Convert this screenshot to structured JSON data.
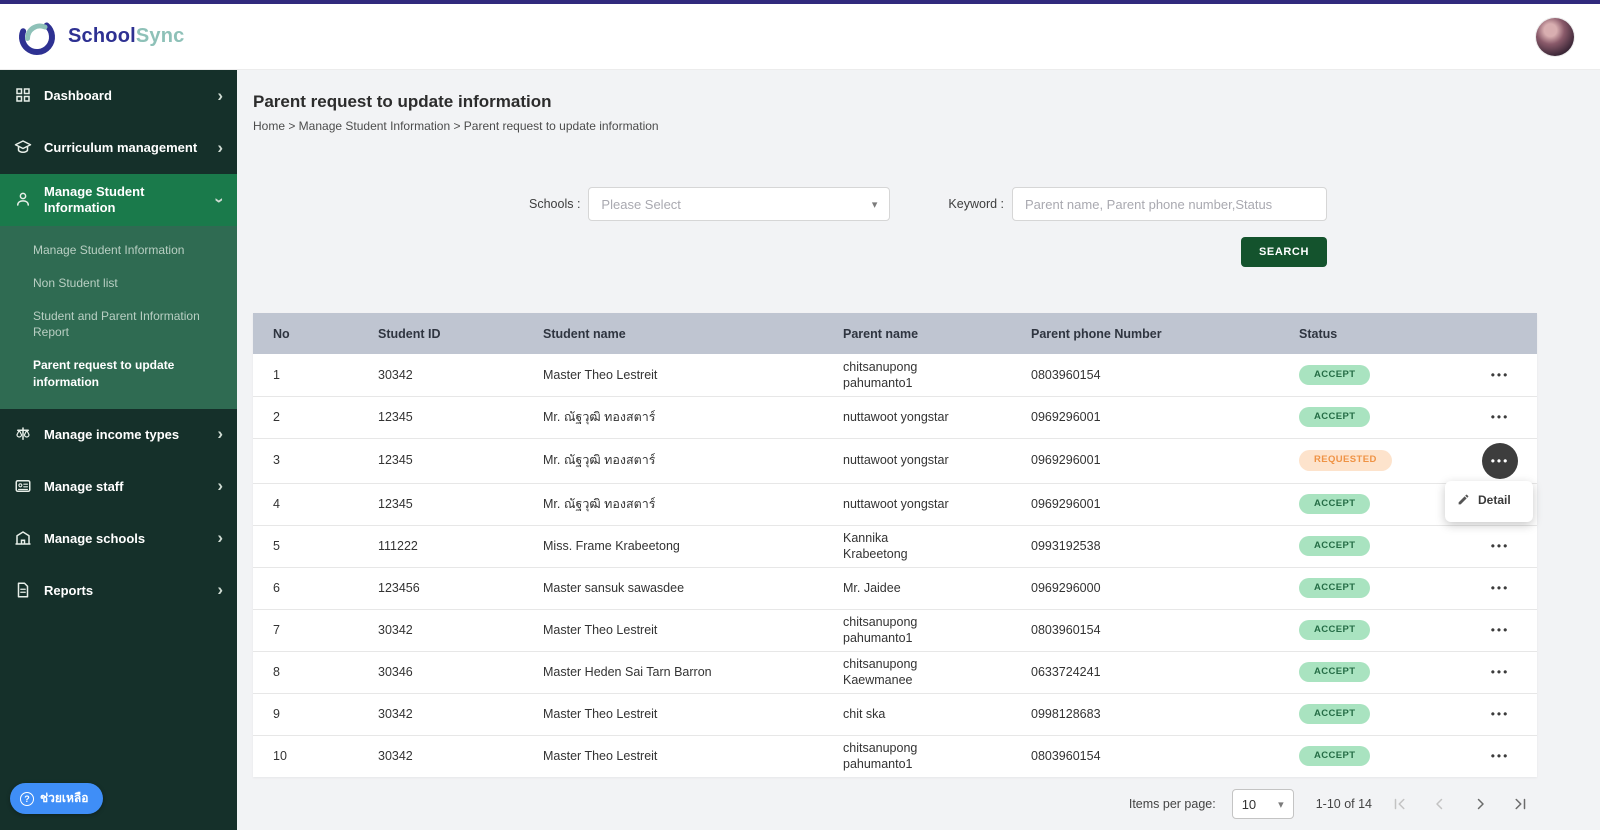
{
  "brand": {
    "school": "School",
    "sync": "Sync"
  },
  "sidebar": {
    "items": [
      {
        "label": "Dashboard",
        "icon": "dashboard-icon"
      },
      {
        "label": "Curriculum management",
        "icon": "curriculum-icon"
      },
      {
        "label": "Manage Student Information",
        "icon": "student-icon",
        "active": true,
        "expanded": true
      },
      {
        "label": "Manage income types",
        "icon": "income-icon"
      },
      {
        "label": "Manage staff",
        "icon": "staff-icon"
      },
      {
        "label": "Manage schools",
        "icon": "schools-icon"
      },
      {
        "label": "Reports",
        "icon": "reports-icon"
      }
    ],
    "submenu": [
      {
        "label": "Manage Student Information",
        "active": false
      },
      {
        "label": "Non Student list",
        "active": false
      },
      {
        "label": "Student and Parent Information Report",
        "active": false
      },
      {
        "label": "Parent request to update information",
        "active": true
      }
    ],
    "help_label": "ช่วยเหลือ"
  },
  "page": {
    "title": "Parent request to update information",
    "breadcrumb": "Home > Manage Student Information > Parent request to update information"
  },
  "filters": {
    "schools_label": "Schools :",
    "schools_placeholder": "Please Select",
    "keyword_label": "Keyword :",
    "keyword_placeholder": "Parent name, Parent phone number,Status",
    "search_label": "SEARCH"
  },
  "table": {
    "columns": [
      "No",
      "Student ID",
      "Student name",
      "Parent name",
      "Parent phone Number",
      "Status"
    ],
    "rows": [
      {
        "no": "1",
        "student_id": "30342",
        "student_name": "Master Theo Lestreit",
        "parent_name": "chitsanupong pahumanto1",
        "phone": "0803960154",
        "status": "ACCEPT"
      },
      {
        "no": "2",
        "student_id": "12345",
        "student_name": "Mr. ณัฐวุฒิ ทองสตาร์",
        "parent_name": "nuttawoot yongstar",
        "phone": "0969296001",
        "status": "ACCEPT"
      },
      {
        "no": "3",
        "student_id": "12345",
        "student_name": "Mr. ณัฐวุฒิ ทองสตาร์",
        "parent_name": "nuttawoot yongstar",
        "phone": "0969296001",
        "status": "REQUESTED",
        "menu_open": true
      },
      {
        "no": "4",
        "student_id": "12345",
        "student_name": "Mr. ณัฐวุฒิ ทองสตาร์",
        "parent_name": "nuttawoot yongstar",
        "phone": "0969296001",
        "status": "ACCEPT"
      },
      {
        "no": "5",
        "student_id": "111222",
        "student_name": "Miss. Frame Krabeetong",
        "parent_name": "Kannika Krabeetong",
        "phone": "0993192538",
        "status": "ACCEPT"
      },
      {
        "no": "6",
        "student_id": "123456",
        "student_name": "Master sansuk sawasdee",
        "parent_name": "Mr. Jaidee",
        "phone": "0969296000",
        "status": "ACCEPT"
      },
      {
        "no": "7",
        "student_id": "30342",
        "student_name": "Master Theo Lestreit",
        "parent_name": "chitsanupong pahumanto1",
        "phone": "0803960154",
        "status": "ACCEPT"
      },
      {
        "no": "8",
        "student_id": "30346",
        "student_name": "Master Heden Sai Tarn Barron",
        "parent_name": "chitsanupong Kaewmanee",
        "phone": "0633724241",
        "status": "ACCEPT"
      },
      {
        "no": "9",
        "student_id": "30342",
        "student_name": "Master Theo Lestreit",
        "parent_name": "chit ska",
        "phone": "0998128683",
        "status": "ACCEPT"
      },
      {
        "no": "10",
        "student_id": "30342",
        "student_name": "Master Theo Lestreit",
        "parent_name": "chitsanupong pahumanto1",
        "phone": "0803960154",
        "status": "ACCEPT"
      }
    ]
  },
  "row_menu": {
    "detail_label": "Detail"
  },
  "pagination": {
    "items_per_page_label": "Items per page:",
    "items_per_page_value": "10",
    "range": "1-10 of 14"
  },
  "colors": {
    "topstrip": "#312a7d",
    "sidebar_bg": "#15302a",
    "sidebar_active": "#1a7a4b",
    "submenu_bg": "#2f6b52",
    "search_btn": "#14532d",
    "accept_bg": "#a9e3c0",
    "accept_text": "#256d46",
    "requested_bg": "#fde3cc",
    "requested_text": "#ef9345",
    "table_head_bg": "#bfc5d1",
    "help_btn": "#3f8ef7",
    "brand_blue": "#2e3192",
    "brand_teal": "#8ec1b8"
  }
}
